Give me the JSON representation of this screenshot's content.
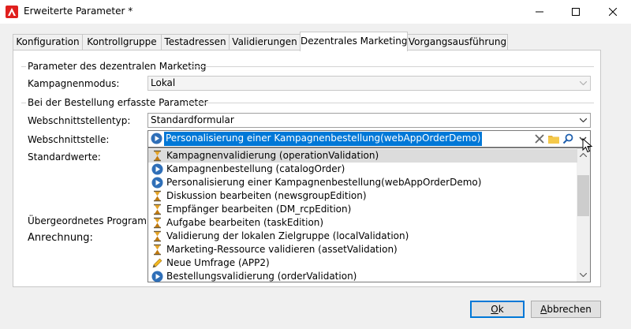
{
  "window": {
    "title": "Erweiterte Parameter *",
    "controls": {
      "minimize_icon": "minimize-icon",
      "maximize_icon": "maximize-icon",
      "close_icon": "close-icon"
    }
  },
  "tabs": [
    {
      "label": "Konfiguration"
    },
    {
      "label": "Kontrollgruppe"
    },
    {
      "label": "Testadressen"
    },
    {
      "label": "Validierungen"
    },
    {
      "label": "Dezentrales Marketing",
      "active": true
    },
    {
      "label": "Vorgangsausführung"
    }
  ],
  "group1": {
    "title": "Parameter des dezentralen Marketing",
    "kampagnenmodus_label": "Kampagnenmodus:",
    "kampagnenmodus_value": "Lokal"
  },
  "group2": {
    "title": "Bei der Bestellung erfasste Parameter",
    "typ_label": "Webschnittstellentyp:",
    "typ_value": "Standardformular",
    "ws_label": "Webschnittstelle:",
    "ws_value": "Personalisierung einer Kampagnenbestellung(webAppOrderDemo)"
  },
  "labels": {
    "standardwerte": "Standardwerte:",
    "uebergeordnet": "Übergeordnetes Programm:",
    "anrechnung": "Anrechnung:"
  },
  "dropdown": {
    "items": [
      {
        "label": "Kampagnenvalidierung (operationValidation)",
        "icon": "hourglass-icon",
        "highlighted": true
      },
      {
        "label": "Kampagnenbestellung (catalogOrder)",
        "icon": "play-circle-icon"
      },
      {
        "label": "Personalisierung einer Kampagnenbestellung(webAppOrderDemo)",
        "icon": "play-circle-icon"
      },
      {
        "label": "Diskussion bearbeiten (newsgroupEdition)",
        "icon": "hourglass-icon"
      },
      {
        "label": "Empfänger bearbeiten (DM_rcpEdition)",
        "icon": "hourglass-icon"
      },
      {
        "label": "Aufgabe bearbeiten (taskEdition)",
        "icon": "hourglass-icon"
      },
      {
        "label": "Validierung der lokalen Zielgruppe (localValidation)",
        "icon": "hourglass-icon"
      },
      {
        "label": "Marketing-Ressource validieren (assetValidation)",
        "icon": "hourglass-icon"
      },
      {
        "label": "Neue Umfrage (APP2)",
        "icon": "pencil-icon"
      },
      {
        "label": "Bestellungsvalidierung (orderValidation)",
        "icon": "play-circle-icon"
      }
    ]
  },
  "buttons": {
    "ok": "Ok",
    "ok_accel": "O",
    "ok_rest": "k",
    "cancel": "Abbrechen",
    "cancel_accel": "A",
    "cancel_rest": "bbrechen"
  },
  "colors": {
    "selection": "#0078d7",
    "app_icon": "#e0201e",
    "hourglass": "#d08a1a",
    "play": "#2f6fb8"
  }
}
